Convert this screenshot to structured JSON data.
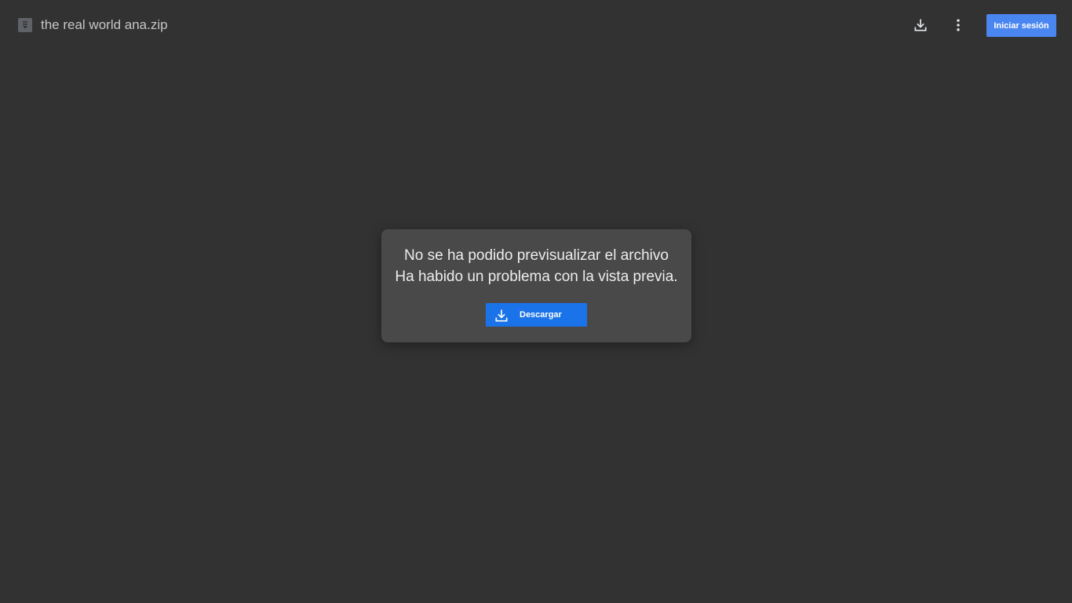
{
  "header": {
    "file_icon": "archive-file-icon",
    "file_name": "the real world ana.zip",
    "download_icon": "download-icon",
    "more_icon": "more-vert-icon",
    "signin_label": "Iniciar sesión",
    "signin_color": "#4a86f0"
  },
  "dialog": {
    "title": "No se ha podido previsualizar el archivo",
    "message": "Ha habido un problema con la vista previa.",
    "download_button": {
      "icon": "download-icon",
      "label": "Descargar",
      "color": "#1a73e8"
    }
  },
  "colors": {
    "background": "#323232",
    "dialog_background": "#4a494a"
  }
}
